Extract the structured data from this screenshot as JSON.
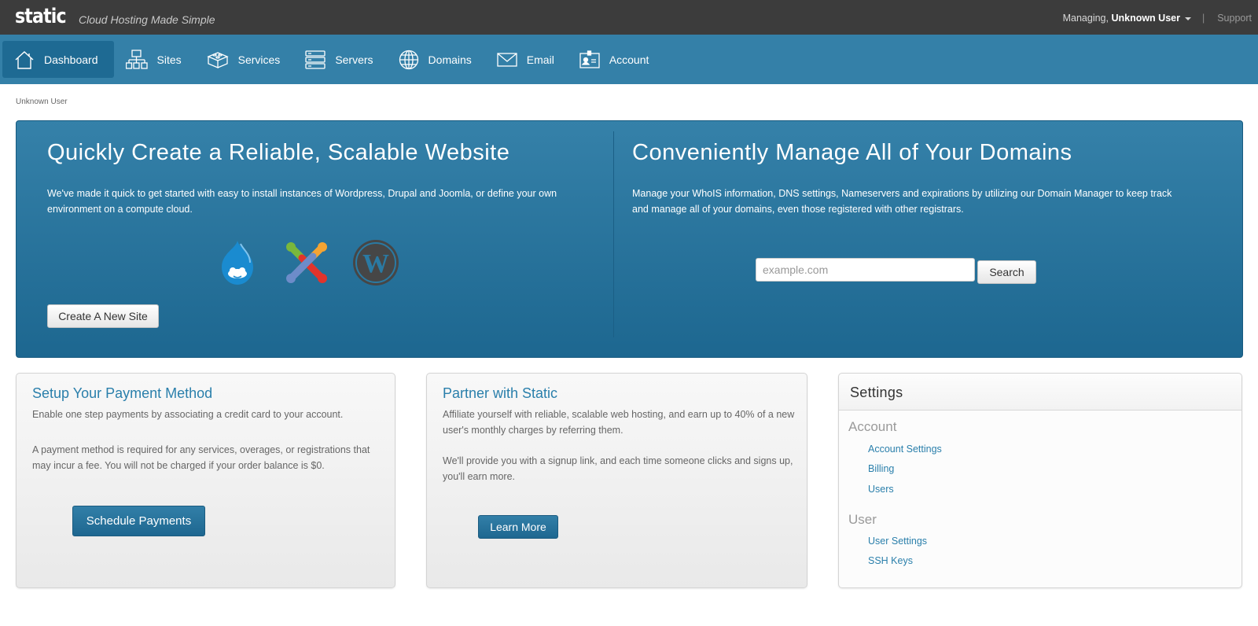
{
  "header": {
    "logo": "static",
    "tagline": "Cloud Hosting Made Simple",
    "managing_prefix": "Managing,",
    "managing_user": "Unknown User",
    "support": "Support"
  },
  "nav": {
    "items": [
      {
        "label": "Dashboard",
        "icon": "home-icon",
        "active": true
      },
      {
        "label": "Sites",
        "icon": "sitemap-icon"
      },
      {
        "label": "Services",
        "icon": "blocks-icon"
      },
      {
        "label": "Servers",
        "icon": "servers-icon"
      },
      {
        "label": "Domains",
        "icon": "globe-icon"
      },
      {
        "label": "Email",
        "icon": "envelope-icon"
      },
      {
        "label": "Account",
        "icon": "id-card-icon"
      }
    ]
  },
  "breadcrumb": "Unknown User",
  "hero": {
    "left": {
      "title": "Quickly Create a Reliable, Scalable Website",
      "text": "We've made it quick to get started with easy to install instances of Wordpress, Drupal and Joomla, or define your own environment on a compute cloud.",
      "logos": [
        "drupal-logo",
        "joomla-logo",
        "wordpress-logo"
      ],
      "button": "Create A New Site"
    },
    "right": {
      "title": "Conveniently Manage All of Your Domains",
      "text": "Manage your WhoIS information, DNS settings, Nameservers and expirations by utilizing our Domain Manager to keep track and manage all of your domains, even those registered with other registrars.",
      "search_placeholder": "example.com",
      "search_value": "",
      "search_button": "Search"
    }
  },
  "cards": {
    "payment": {
      "title": "Setup Your Payment Method",
      "p1": "Enable one step payments by associating a credit card to your account.",
      "p2": "A payment method is required for any services, overages, or registrations that may incur a fee. You will not be charged if your order balance is $0.",
      "button": "Schedule Payments"
    },
    "partner": {
      "title": "Partner with Static",
      "p1": "Affiliate yourself with reliable, scalable web hosting, and earn up to 40% of a new user's monthly charges by referring them.",
      "p2": "We'll provide you with a signup link, and each time someone clicks and signs up, you'll earn more.",
      "button": "Learn More"
    }
  },
  "settings": {
    "title": "Settings",
    "groups": [
      {
        "label": "Account",
        "links": [
          "Account Settings",
          "Billing",
          "Users"
        ]
      },
      {
        "label": "User",
        "links": [
          "User Settings",
          "SSH Keys"
        ]
      }
    ]
  },
  "colors": {
    "topbar": "#3c3c3c",
    "nav": "#3480a8",
    "nav_active": "#1e6a93",
    "accent": "#2a7fab"
  }
}
